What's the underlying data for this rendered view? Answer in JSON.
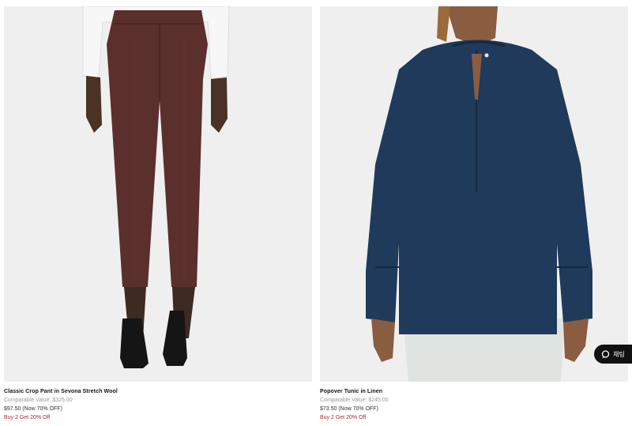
{
  "products": [
    {
      "name": "Classic Crop Pant in Sevona Stretch Wool",
      "comparable": "Comparable Value: $325.00",
      "price": "$97.50 (Now 70% OFF)",
      "promo": "Buy 2 Get 20% Off",
      "image": "brown-cropped-trousers-model-photo"
    },
    {
      "name": "Popover Tunic in Linen",
      "comparable": "Comparable Value: $245.00",
      "price": "$73.50 (Now 70% OFF)",
      "promo": "Buy 2 Get 20% Off",
      "image": "navy-linen-tunic-model-photo"
    }
  ],
  "chat": {
    "label": "채팅",
    "icon": "chat-bubble-icon"
  },
  "colors": {
    "promo": "#b22a2a",
    "photo_bg": "#efefef",
    "chat_bg": "#111111"
  }
}
